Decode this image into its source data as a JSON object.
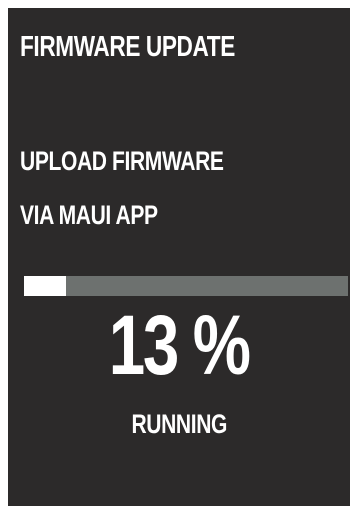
{
  "screen": {
    "title": "FIRMWARE UPDATE",
    "message_line1": "UPLOAD FIRMWARE",
    "message_line2": "VIA MAUI APP"
  },
  "progress": {
    "fraction": 0.13,
    "percent_text": "13 %",
    "status": "RUNNING",
    "fill_color": "#ffffff",
    "track_color": "#6d716f"
  },
  "colors": {
    "background": "#2c2a2a",
    "text": "#ffffff"
  }
}
